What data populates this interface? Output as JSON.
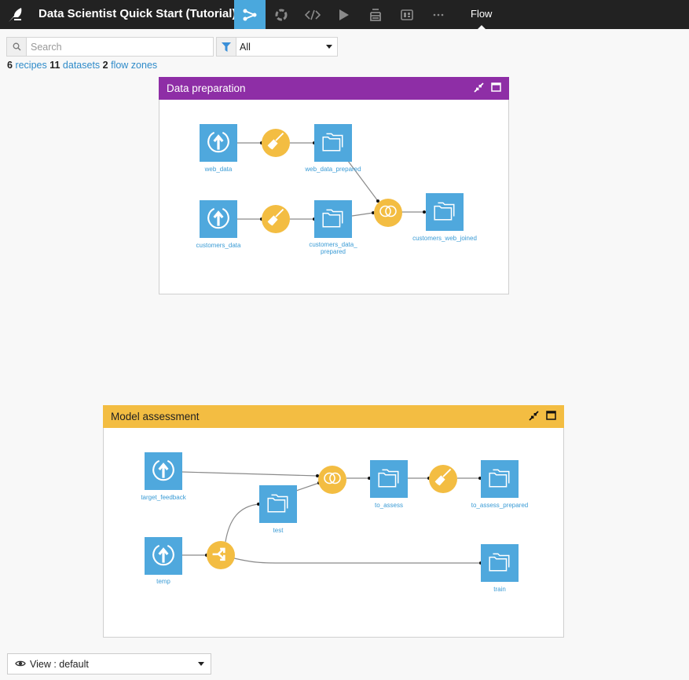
{
  "header": {
    "project_title": "Data Scientist Quick Start (Tutorial)",
    "nav_icons": [
      "flow-icon",
      "ml-icon",
      "code-icon",
      "run-icon",
      "datasets-icon",
      "dashboard-icon",
      "more-icon"
    ],
    "current_section": "Flow",
    "accent_color": "#4aa8dd"
  },
  "toolbar": {
    "search_placeholder": "Search",
    "search_value": "",
    "filter_value": "All"
  },
  "counts": {
    "recipes_count": "6",
    "recipes_label": "recipes",
    "datasets_count": "11",
    "datasets_label": "datasets",
    "zones_count": "2",
    "zones_label": "flow zones"
  },
  "zones": [
    {
      "name": "Data preparation",
      "color": "#8e2ea6",
      "datasets": [
        "web_data",
        "web_data_prepared",
        "customers_data",
        "customers_data_prepared",
        "customers_web_joined"
      ],
      "recipes": [
        "prepare",
        "prepare",
        "join"
      ]
    },
    {
      "name": "Model assessment",
      "color": "#f3bd42",
      "datasets": [
        "target_feedback",
        "test",
        "to_assess",
        "to_assess_prepared",
        "temp",
        "train"
      ],
      "recipes": [
        "join",
        "prepare",
        "split"
      ]
    }
  ],
  "nodes": {
    "web_data": "web_data",
    "web_data_prepared": "web_data_prepared",
    "customers_data": "customers_data",
    "customers_data_prepared_1": "customers_data_",
    "customers_data_prepared_2": "prepared",
    "customers_web_joined": "customers_web_joined",
    "target_feedback": "target_feedback",
    "test": "test",
    "to_assess": "to_assess",
    "to_assess_prepared": "to_assess_prepared",
    "temp": "temp",
    "train": "train"
  },
  "view": {
    "label": "View : default"
  }
}
